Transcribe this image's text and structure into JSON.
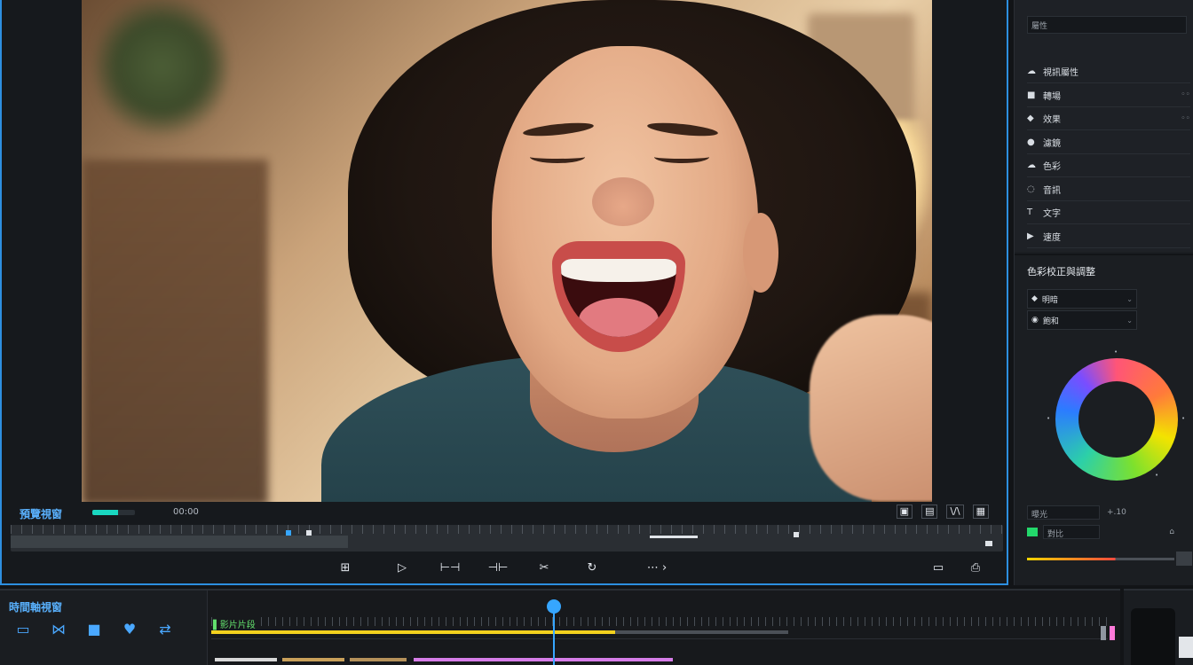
{
  "preview": {
    "label": "預覽視窗",
    "timecode": "00:00",
    "progress": 0.6,
    "view_buttons": [
      "▣",
      "▤",
      "\\/\\",
      "▦"
    ],
    "transport": {
      "grid": "⊞",
      "play": "▷",
      "in_point": "⊢⊣",
      "out_point": "⊣⊢",
      "split": "✂",
      "rotate": "↻",
      "more": "⋯ ›",
      "fit": "▭",
      "camera": "⎙"
    }
  },
  "inspector": {
    "header_input": "屬性",
    "rows": [
      {
        "icon": "☁",
        "label": "視訊屬性",
        "value": ""
      },
      {
        "icon": "■",
        "label": "轉場",
        "value": "◦◦"
      },
      {
        "icon": "◆",
        "label": "效果",
        "value": "◦◦"
      },
      {
        "icon": "●",
        "label": "濾鏡",
        "value": ""
      },
      {
        "icon": "☁",
        "label": "色彩",
        "value": ""
      },
      {
        "icon": "◌",
        "label": "音訊",
        "value": ""
      },
      {
        "icon": "T",
        "label": "文字",
        "value": ""
      },
      {
        "icon": "▶",
        "label": "速度",
        "value": ""
      }
    ],
    "color_wheel": {
      "title": "色彩校正與調整",
      "fields": [
        {
          "icon": "◆",
          "label": "明暗",
          "chevron": "⌄"
        },
        {
          "icon": "◉",
          "label": "飽和",
          "chevron": "⌄"
        }
      ]
    },
    "bottom": {
      "field_1": "曝光",
      "value_1": "+.10",
      "field_2": "對比",
      "icon": "⌂"
    }
  },
  "timeline": {
    "title": "時間軸視窗",
    "tools": [
      "▭",
      "⋈",
      "■",
      "♥",
      "⇄"
    ],
    "clip_label": "▌影片片段"
  },
  "colors": {
    "accent": "#2d8fe0",
    "playhead": "#36a6ff",
    "track_yellow": "#f3d11e",
    "clip_label_green": "#62e06e"
  }
}
